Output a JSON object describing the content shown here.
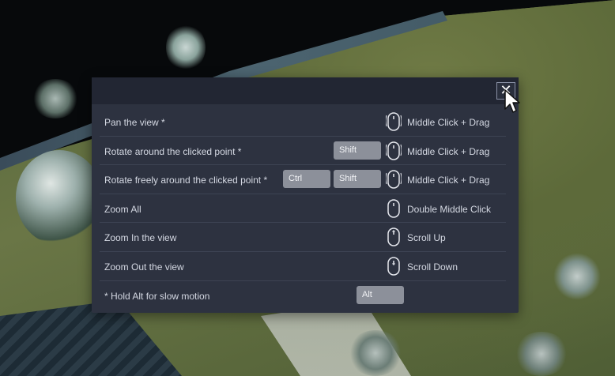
{
  "dialog": {
    "close_label": "✕",
    "footer_note": "* Hold Alt for slow motion",
    "footer_key": "Alt"
  },
  "shortcuts": [
    {
      "label": "Pan the view *",
      "keys": [],
      "mouse_icon": "mouse-middle-drag-icon",
      "action": "Middle Click + Drag"
    },
    {
      "label": "Rotate around the clicked point *",
      "keys": [
        "Shift"
      ],
      "mouse_icon": "mouse-middle-drag-icon",
      "action": "Middle Click + Drag"
    },
    {
      "label": "Rotate freely around the clicked point *",
      "keys": [
        "Ctrl",
        "Shift"
      ],
      "mouse_icon": "mouse-middle-drag-icon",
      "action": "Middle Click + Drag"
    },
    {
      "label": "Zoom All",
      "keys": [],
      "mouse_icon": "mouse-middle-click-icon",
      "action": "Double Middle Click"
    },
    {
      "label": "Zoom In the view",
      "keys": [],
      "mouse_icon": "mouse-scroll-up-icon",
      "action": "Scroll Up"
    },
    {
      "label": "Zoom Out the view",
      "keys": [],
      "mouse_icon": "mouse-scroll-down-icon",
      "action": "Scroll Down"
    }
  ],
  "colors": {
    "dialog_bg": "#2d3240",
    "header_bg": "#222633",
    "key_bg": "#8c909a",
    "text": "#d4d8e2"
  }
}
